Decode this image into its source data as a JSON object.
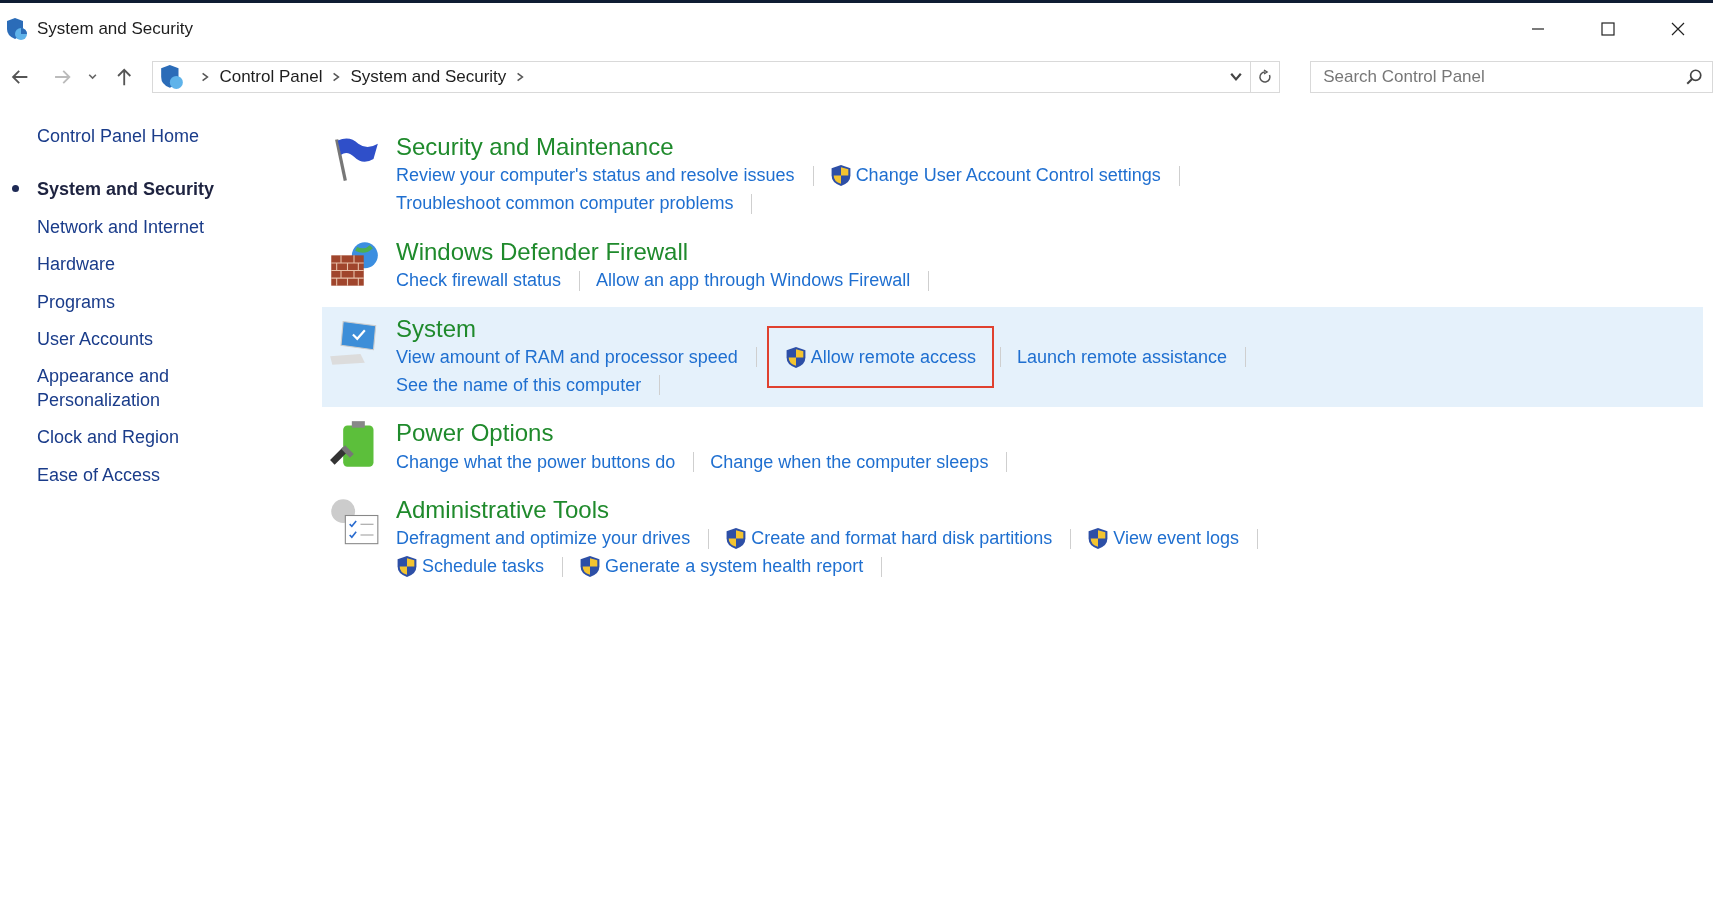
{
  "window": {
    "title": "System and Security"
  },
  "address_bar": {
    "breadcrumbs": [
      "Control Panel",
      "System and Security"
    ]
  },
  "search": {
    "placeholder": "Search Control Panel"
  },
  "sidebar": {
    "items": [
      {
        "label": "Control Panel Home",
        "selected": false
      },
      {
        "label": "System and Security",
        "selected": true
      },
      {
        "label": "Network and Internet",
        "selected": false
      },
      {
        "label": "Hardware",
        "selected": false
      },
      {
        "label": "Programs",
        "selected": false
      },
      {
        "label": "User Accounts",
        "selected": false
      },
      {
        "label": "Appearance and Personalization",
        "selected": false
      },
      {
        "label": "Clock and Region",
        "selected": false
      },
      {
        "label": "Ease of Access",
        "selected": false
      }
    ]
  },
  "categories": [
    {
      "kind": "flag",
      "title": "Security and Maintenance",
      "highlighted": false,
      "lines": [
        [
          {
            "text": "Review your computer's status and resolve issues",
            "shield": false,
            "outlined": false
          },
          {
            "text": "Change User Account Control settings",
            "shield": true,
            "outlined": false
          }
        ],
        [
          {
            "text": "Troubleshoot common computer problems",
            "shield": false,
            "outlined": false
          }
        ]
      ]
    },
    {
      "kind": "firewall",
      "title": "Windows Defender Firewall",
      "highlighted": false,
      "lines": [
        [
          {
            "text": "Check firewall status",
            "shield": false,
            "outlined": false
          },
          {
            "text": "Allow an app through Windows Firewall",
            "shield": false,
            "outlined": false
          }
        ]
      ]
    },
    {
      "kind": "computer",
      "title": "System",
      "highlighted": true,
      "lines": [
        [
          {
            "text": "View amount of RAM and processor speed",
            "shield": false,
            "outlined": false
          },
          {
            "text": "Allow remote access",
            "shield": true,
            "outlined": true
          },
          {
            "text": "Launch remote assistance",
            "shield": false,
            "outlined": false
          }
        ],
        [
          {
            "text": "See the name of this computer",
            "shield": false,
            "outlined": false
          }
        ]
      ]
    },
    {
      "kind": "battery",
      "title": "Power Options",
      "highlighted": false,
      "lines": [
        [
          {
            "text": "Change what the power buttons do",
            "shield": false,
            "outlined": false
          },
          {
            "text": "Change when the computer sleeps",
            "shield": false,
            "outlined": false
          }
        ]
      ]
    },
    {
      "kind": "tools",
      "title": "Administrative Tools",
      "highlighted": false,
      "lines": [
        [
          {
            "text": "Defragment and optimize your drives",
            "shield": false,
            "outlined": false
          },
          {
            "text": "Create and format hard disk partitions",
            "shield": true,
            "outlined": false
          },
          {
            "text": "View event logs",
            "shield": true,
            "outlined": false
          }
        ],
        [
          {
            "text": "Schedule tasks",
            "shield": true,
            "outlined": false
          },
          {
            "text": "Generate a system health report",
            "shield": true,
            "outlined": false
          }
        ]
      ]
    }
  ]
}
